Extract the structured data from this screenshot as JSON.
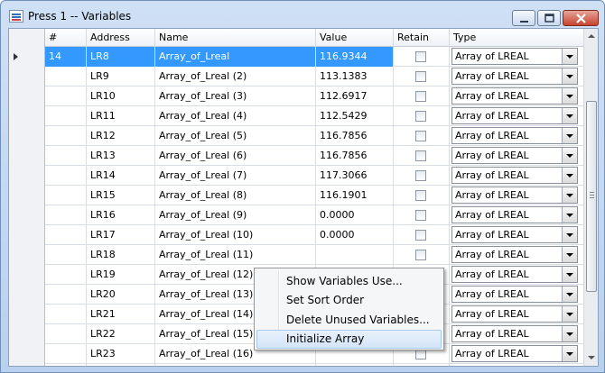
{
  "window": {
    "title": "Press 1 -- Variables"
  },
  "columns": {
    "num": "#",
    "address": "Address",
    "name": "Name",
    "value": "Value",
    "retain": "Retain",
    "type": "Type"
  },
  "rows": [
    {
      "num": "14",
      "address": "LR8",
      "name": "Array_of_Lreal",
      "value": "116.9344",
      "retain": false,
      "type": "Array of LREAL",
      "selected": true
    },
    {
      "num": "",
      "address": "LR9",
      "name": "Array_of_Lreal (2)",
      "value": "113.1383",
      "retain": false,
      "type": "Array of LREAL"
    },
    {
      "num": "",
      "address": "LR10",
      "name": "Array_of_Lreal (3)",
      "value": "112.6917",
      "retain": false,
      "type": "Array of LREAL"
    },
    {
      "num": "",
      "address": "LR11",
      "name": "Array_of_Lreal (4)",
      "value": "112.5429",
      "retain": false,
      "type": "Array of LREAL"
    },
    {
      "num": "",
      "address": "LR12",
      "name": "Array_of_Lreal (5)",
      "value": "116.7856",
      "retain": false,
      "type": "Array of LREAL"
    },
    {
      "num": "",
      "address": "LR13",
      "name": "Array_of_Lreal (6)",
      "value": "116.7856",
      "retain": false,
      "type": "Array of LREAL"
    },
    {
      "num": "",
      "address": "LR14",
      "name": "Array_of_Lreal (7)",
      "value": "117.3066",
      "retain": false,
      "type": "Array of LREAL"
    },
    {
      "num": "",
      "address": "LR15",
      "name": "Array_of_Lreal (8)",
      "value": "116.1901",
      "retain": false,
      "type": "Array of LREAL"
    },
    {
      "num": "",
      "address": "LR16",
      "name": "Array_of_Lreal (9)",
      "value": "0.0000",
      "retain": false,
      "type": "Array of LREAL"
    },
    {
      "num": "",
      "address": "LR17",
      "name": "Array_of_Lreal (10)",
      "value": "0.0000",
      "retain": false,
      "type": "Array of LREAL"
    },
    {
      "num": "",
      "address": "LR18",
      "name": "Array_of_Lreal (11)",
      "value": "",
      "retain": false,
      "type": "Array of LREAL"
    },
    {
      "num": "",
      "address": "LR19",
      "name": "Array_of_Lreal (12)",
      "value": "",
      "retain": false,
      "type": "Array of LREAL"
    },
    {
      "num": "",
      "address": "LR20",
      "name": "Array_of_Lreal (13)",
      "value": "",
      "retain": false,
      "type": "Array of LREAL"
    },
    {
      "num": "",
      "address": "LR21",
      "name": "Array_of_Lreal (14)",
      "value": "",
      "retain": false,
      "type": "Array of LREAL"
    },
    {
      "num": "",
      "address": "LR22",
      "name": "Array_of_Lreal (15)",
      "value": "",
      "retain": false,
      "type": "Array of LREAL"
    },
    {
      "num": "",
      "address": "LR23",
      "name": "Array_of_Lreal (16)",
      "value": "",
      "retain": false,
      "type": "Array of LREAL"
    },
    {
      "num": "",
      "address": "",
      "name": "",
      "value": "",
      "retain": false,
      "type": ""
    }
  ],
  "context_menu": {
    "items": [
      {
        "label": "Show Variables Use...",
        "highlighted": false
      },
      {
        "label": "Set Sort Order",
        "highlighted": false
      },
      {
        "label": "Delete Unused Variables...",
        "highlighted": false
      },
      {
        "label": "Initialize Array",
        "highlighted": true
      }
    ]
  },
  "icons": {
    "app": "variables-window-icon",
    "minimize": "minimize-icon",
    "maximize": "maximize-icon",
    "close": "close-icon",
    "row_pointer": "current-row-arrow-icon",
    "dropdown": "chevron-down-icon"
  },
  "colors": {
    "selection": "#3399ff",
    "menu_highlight": "#d4e5f8",
    "close_button": "#c8432f"
  }
}
